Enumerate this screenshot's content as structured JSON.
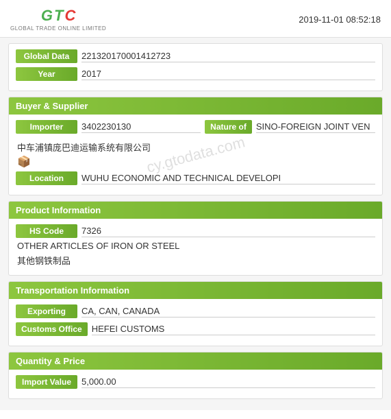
{
  "topBar": {
    "logo": {
      "text": "GTC",
      "subtitle": "GLOBAL TRADE ONLINE LIMITED"
    },
    "timestamp": "2019-11-01 08:52:18"
  },
  "sections": {
    "globalInfo": {
      "fields": [
        {
          "label": "Global Data",
          "value": "221320170001412723"
        },
        {
          "label": "Year",
          "value": "2017"
        }
      ]
    },
    "buyerSupplier": {
      "header": "Buyer & Supplier",
      "importer": {
        "label": "Importer",
        "value": "3402230130"
      },
      "nature": {
        "label": "Nature of",
        "value": "SINO-FOREIGN JOINT VEN"
      },
      "companyName": "中车浦镇庞巴迪运输系统有限公司",
      "companyIcon": "📦",
      "location": {
        "label": "Location",
        "value": "WUHU ECONOMIC AND TECHNICAL DEVELOPI"
      }
    },
    "productInfo": {
      "header": "Product Information",
      "hsCode": {
        "label": "HS Code",
        "value": "7326"
      },
      "descEn": "OTHER ARTICLES OF IRON OR STEEL",
      "descZh": "其他钢铁制品"
    },
    "transportInfo": {
      "header": "Transportation Information",
      "exporting": {
        "label": "Exporting",
        "value": "CA, CAN, CANADA"
      },
      "customsOffice": {
        "label": "Customs Office",
        "value": "HEFEI CUSTOMS"
      }
    },
    "quantityPrice": {
      "header": "Quantity & Price",
      "importValue": {
        "label": "Import Value",
        "value": "5,000.00"
      }
    }
  },
  "watermark": "cy.gtodata.com"
}
